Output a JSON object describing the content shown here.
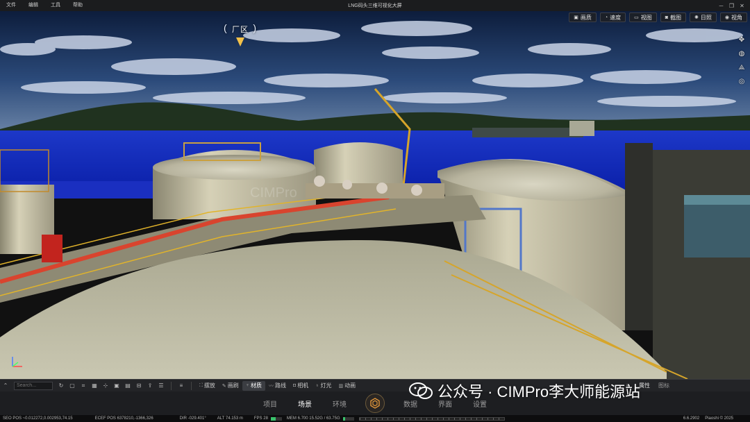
{
  "menubar": {
    "items": [
      "文件",
      "编辑",
      "工具",
      "帮助"
    ],
    "title": "LNG码头三维可视化大屏"
  },
  "viewport": {
    "zone_label": "厂区",
    "view_buttons": [
      {
        "label": "画质",
        "icon": "image-icon"
      },
      {
        "label": "速度",
        "icon": "speed-icon"
      },
      {
        "label": "视图",
        "icon": "viewport-icon"
      },
      {
        "label": "截图",
        "icon": "screenshot-icon"
      },
      {
        "label": "日照",
        "icon": "sun-icon"
      },
      {
        "label": "视角",
        "icon": "eye-icon"
      }
    ],
    "side_tools": [
      "move-icon",
      "orbit-icon",
      "pan-icon",
      "globe-icon"
    ]
  },
  "toolbar": {
    "search_placeholder": "Search...",
    "tabs": [
      {
        "label": "摆放",
        "icon": "place-icon"
      },
      {
        "label": "画刷",
        "icon": "brush-icon"
      },
      {
        "label": "材质",
        "icon": "material-icon",
        "active": true
      },
      {
        "label": "路线",
        "icon": "route-icon"
      },
      {
        "label": "相机",
        "icon": "camera-icon"
      },
      {
        "label": "灯光",
        "icon": "light-icon"
      },
      {
        "label": "动画",
        "icon": "animation-icon"
      }
    ],
    "panel_tabs": [
      "属性",
      "图标"
    ]
  },
  "bottomnav": {
    "left": [
      "项目",
      "场景",
      "环境"
    ],
    "right": [
      "数据",
      "界面",
      "设置"
    ],
    "active": "场景"
  },
  "watermark": "公众号 · CIMPro李大师能源站",
  "statusbar": {
    "seo_pos": "SEO POS ~0.012272,0.002953,74.15",
    "ecef_pos": "ECEF POS 6378210,-1366,326",
    "dir": "DIR -029.401°",
    "alt": "ALT 74.153 m",
    "fps": "FPS 28",
    "mem": "MEM 6.700 15.52G / 63.75G",
    "version": "6.6.2902",
    "copyright": "Piaoshi © 2025",
    "fps_level": 0.45,
    "mem_level": 0.24
  },
  "colors": {
    "accent": "#f3c14a",
    "toolbar_bg": "#232427",
    "nav_bg": "#1d1e21"
  }
}
